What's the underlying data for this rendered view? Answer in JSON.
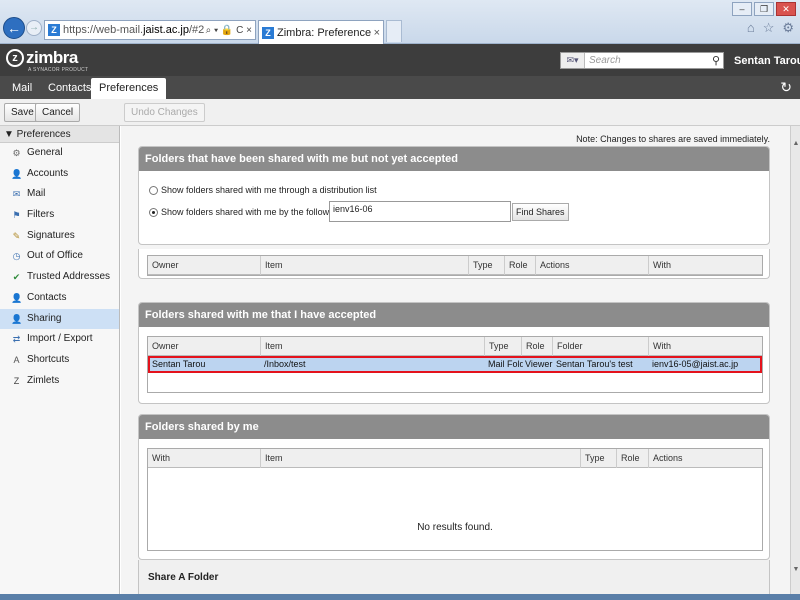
{
  "browser": {
    "url_prefix": "https://web-mail.",
    "url_domain": "jaist.ac.jp",
    "url_suffix": "/#2",
    "address_icons": "⌕ ▾ 🔒 C ×",
    "tab_title": "Zimbra: Preferences: S...",
    "tab_close": "×",
    "favicon_letter": "Z",
    "back_glyph": "←",
    "forward_glyph": "→"
  },
  "header": {
    "logo_text": "zimbra",
    "logo_tagline": "A SYNACOR PRODUCT",
    "search_placeholder": "Search",
    "user_name": "Sentan Tarou ▾"
  },
  "apptabs": [
    {
      "label": "Mail"
    },
    {
      "label": "Contacts"
    },
    {
      "label": "Preferences"
    }
  ],
  "toolbar": {
    "save_label": "Save",
    "cancel_label": "Cancel",
    "undo_label": "Undo Changes"
  },
  "sidebar": {
    "header": "▼ Preferences",
    "items": [
      {
        "label": "General",
        "icon": "gear-icon",
        "glyph": "⚙",
        "color": "#6a6a6a"
      },
      {
        "label": "Accounts",
        "icon": "accounts-icon",
        "glyph": "👤",
        "color": "#3a6fb0"
      },
      {
        "label": "Mail",
        "icon": "mail-icon",
        "glyph": "✉",
        "color": "#3a6fb0"
      },
      {
        "label": "Filters",
        "icon": "filters-icon",
        "glyph": "⚑",
        "color": "#3a6fb0"
      },
      {
        "label": "Signatures",
        "icon": "signature-icon",
        "glyph": "✎",
        "color": "#b08a2a"
      },
      {
        "label": "Out of Office",
        "icon": "out-of-office-icon",
        "glyph": "◷",
        "color": "#3a6fb0"
      },
      {
        "label": "Trusted Addresses",
        "icon": "shield-icon",
        "glyph": "✔",
        "color": "#2e8b3a"
      },
      {
        "label": "Contacts",
        "icon": "contacts-icon",
        "glyph": "👤",
        "color": "#3a6fb0"
      },
      {
        "label": "Sharing",
        "icon": "sharing-icon",
        "glyph": "👤",
        "color": "#3a6fb0"
      },
      {
        "label": "Import / Export",
        "icon": "import-export-icon",
        "glyph": "⇄",
        "color": "#3a6fb0"
      },
      {
        "label": "Shortcuts",
        "icon": "shortcuts-icon",
        "glyph": "A",
        "color": "#555555"
      },
      {
        "label": "Zimlets",
        "icon": "zimlets-icon",
        "glyph": "Z",
        "color": "#444444"
      }
    ]
  },
  "main": {
    "note": "Note: Changes to shares are saved immediately.",
    "pending": {
      "title": "Folders that have been shared with me but not yet accepted",
      "option_dl": "Show folders shared with me through a distribution list",
      "option_user": "Show folders shared with me by the following user:",
      "user_value": "ienv16-06",
      "find_label": "Find Shares",
      "columns": [
        "Owner",
        "Item",
        "Type",
        "Role",
        "Actions",
        "With"
      ]
    },
    "accepted": {
      "title": "Folders shared with me that I have accepted",
      "columns": [
        "Owner",
        "Item",
        "Type",
        "Role",
        "Folder",
        "With"
      ],
      "rows": [
        {
          "owner": "Sentan Tarou",
          "item": "/Inbox/test",
          "type": "Mail Folder",
          "role": "Viewer",
          "folder": "Sentan  Tarou's test",
          "with": "ienv16-05@jaist.ac.jp"
        }
      ]
    },
    "byme": {
      "title": "Folders shared by me",
      "columns": [
        "With",
        "Item",
        "Type",
        "Role",
        "Actions"
      ],
      "empty_text": "No results found."
    },
    "share_folder": {
      "title": "Share A Folder"
    }
  }
}
